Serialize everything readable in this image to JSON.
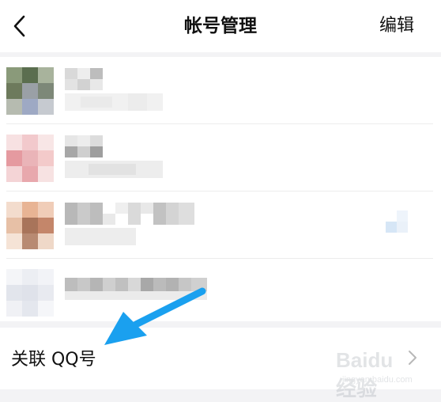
{
  "header": {
    "title": "帐号管理",
    "edit_label": "编辑"
  },
  "icons": {
    "back": "chevron-left-icon",
    "row_chevron": "chevron-right-icon",
    "annotation": "arrow-annotation"
  },
  "accounts": [
    {
      "avatar_colors": [
        "#8a9a7a",
        "#5b6e4f",
        "#a8b39c",
        "#6f7d86"
      ]
    },
    {
      "avatar_colors": [
        "#f2c9cc",
        "#e59aa0",
        "#f6dada",
        "#eab4b8"
      ]
    },
    {
      "avatar_colors": [
        "#e8b494",
        "#c4866a",
        "#f0d6c2",
        "#a8745a"
      ]
    },
    {
      "avatar_colors": [
        "#eceef3",
        "#e2e5ec",
        "#f2f3f7",
        "#dfe2ea"
      ]
    }
  ],
  "link_row": {
    "label": "关联 QQ号"
  },
  "watermark": {
    "main": "Baidu 经验",
    "sub": "jingyan.baidu.com"
  },
  "colors": {
    "background": "#f3f3f5",
    "arrow": "#1aa0ef",
    "text": "#111111"
  }
}
